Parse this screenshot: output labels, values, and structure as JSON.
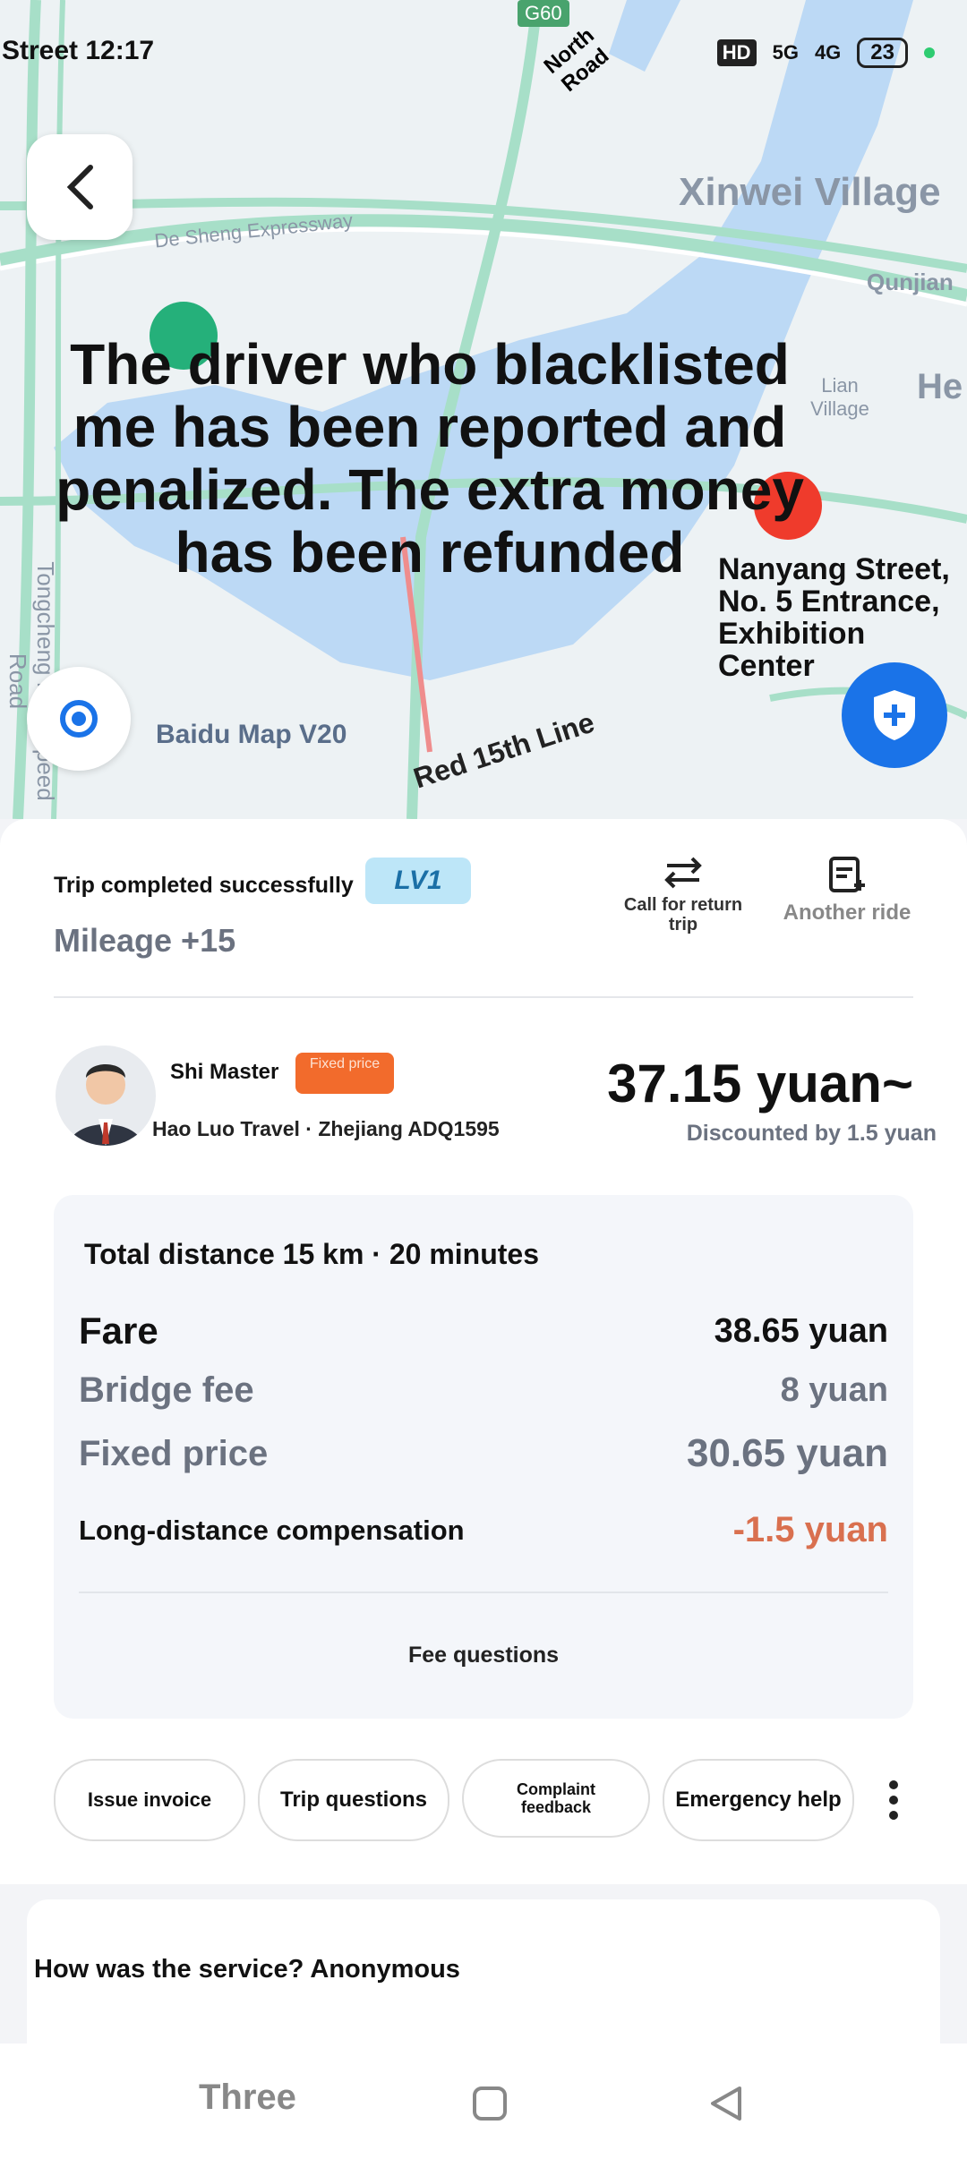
{
  "status_bar": {
    "time": "Street 12:17",
    "network_badge": "HD",
    "signal_1": "5G",
    "signal_2": "4G",
    "battery": "23"
  },
  "map": {
    "labels": {
      "g60": "G60",
      "north_road": "North Road",
      "xinwei": "Xinwei Village",
      "desheng": "De Sheng Expressway",
      "qunjian": "Qunjian",
      "lian": "Lian Village",
      "he": "He",
      "tongcheng": "Tongcheng High-speed Road",
      "baidu": "Baidu Map V20",
      "red_line": "Red 15th Line"
    },
    "caption": "The driver who blacklisted me has been reported and penalized. The extra money has been refunded",
    "destination": "Nanyang Street, No. 5 Entrance, Exhibition Center"
  },
  "trip": {
    "status": "Trip completed successfully",
    "level_badge": "LV1",
    "mileage": "Mileage +15",
    "call_return": "Call for return trip",
    "another_ride": "Another ride"
  },
  "driver": {
    "name": "Shi Master",
    "tag": "Fixed price",
    "company": "Hao Luo Travel · Zhejiang ADQ1595",
    "price": "37.15 yuan~",
    "discount": "Discounted by 1.5 yuan"
  },
  "fees": {
    "summary": "Total distance 15 km · 20 minutes",
    "fare_label": "Fare",
    "fare_value": "38.65 yuan",
    "bridge_label": "Bridge fee",
    "bridge_value": "8 yuan",
    "fixed_label": "Fixed price",
    "fixed_value": "30.65 yuan",
    "comp_label": "Long-distance compensation",
    "comp_value": "-1.5 yuan",
    "questions": "Fee questions"
  },
  "actions": {
    "invoice": "Issue invoice",
    "trip_q": "Trip questions",
    "complaint": "Complaint feedback",
    "emergency": "Emergency help"
  },
  "rating": {
    "prompt": "How was the service? Anonymous"
  },
  "navbar": {
    "menu_label": "Three"
  },
  "colors": {
    "accent_blue": "#1a73e8",
    "orange_tag": "#f26b2c",
    "negative": "#d9704f",
    "road_green": "#a7dfc8",
    "water": "#bcd9f5"
  }
}
